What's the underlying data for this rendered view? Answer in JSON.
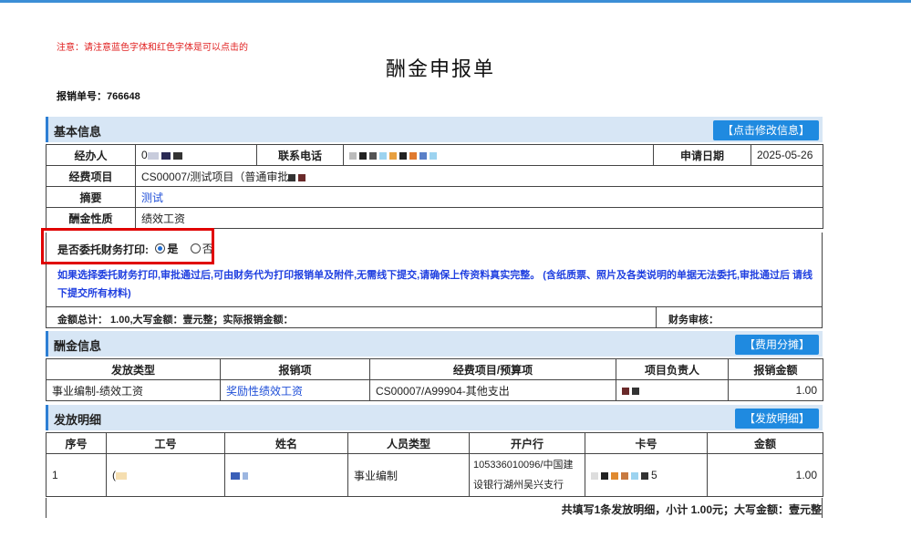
{
  "notice": "注意：请注意蓝色字体和红色字体是可以点击的",
  "title": "酬金申报单",
  "doc_no_label": "报销单号：",
  "doc_no": "766648",
  "basic": {
    "section_title": "基本信息",
    "edit_button": "【点击修改信息】",
    "handler_label": "经办人",
    "handler_value": "0",
    "phone_label": "联系电话",
    "date_label": "申请日期",
    "date_value": "2025-05-26",
    "project_label": "经费项目",
    "project_value": "CS00007/测试项目（普通审批",
    "summary_label": "摘要",
    "summary_value": "测试",
    "nature_label": "酬金性质",
    "nature_value": "绩效工资",
    "print_question": "是否委托财务打印:",
    "opt_yes": "是",
    "opt_no": "否",
    "selected": "是",
    "hint": "如果选择委托财务打印,审批通过后,可由财务代为打印报销单及附件,无需线下提交,请确保上传资料真实完整。 (含纸质票、照片及各类说明的单据无法委托,审批通过后 请线下提交所有材料)",
    "total_text": "金额总计： 1.00,大写金额：壹元整；实际报销金额：",
    "audit_label": "财务审核："
  },
  "reward": {
    "section_title": "酬金信息",
    "split_button": "【费用分摊】",
    "headers": [
      "发放类型",
      "报销项",
      "经费项目/预算项",
      "项目负责人",
      "报销金额"
    ],
    "rows": [
      {
        "type": "事业编制-绩效工资",
        "item": "奖励性绩效工资",
        "budget": "CS00007/A99904-其他支出",
        "leader": "",
        "amount": "1.00"
      }
    ]
  },
  "detail": {
    "section_title": "发放明细",
    "detail_button": "【发放明细】",
    "headers": [
      "序号",
      "工号",
      "姓名",
      "人员类型",
      "开户行",
      "卡号",
      "金额"
    ],
    "rows": [
      {
        "no": "1",
        "emp_id": "(",
        "name": "",
        "person_type": "事业编制",
        "bank": "105336010096/中国建设银行湖州吴兴支行",
        "card": "5",
        "amount": "1.00"
      }
    ],
    "footer": "共填写1条发放明细，小计 1.00元；大写金额：壹元整"
  },
  "colors": {
    "accent": "#1f8ae0",
    "link": "#1f4fd8",
    "warning": "#e02020",
    "section_bg": "#d7e6f5"
  }
}
